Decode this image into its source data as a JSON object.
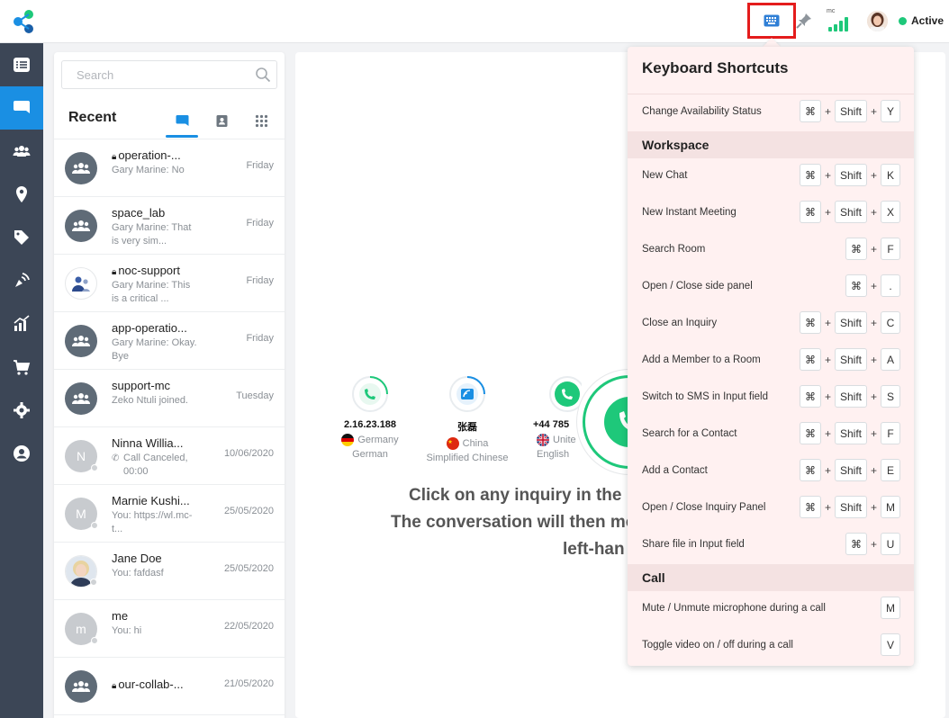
{
  "topbar": {
    "signal_label": "mc",
    "status_label": "Active",
    "status_color": "#1ec87a"
  },
  "nav": {
    "items": [
      "dashboard-icon",
      "chat-icon",
      "contacts-icon",
      "location-icon",
      "tag-icon",
      "broadcast-icon",
      "analytics-icon",
      "cart-icon",
      "settings-icon",
      "profile-icon"
    ],
    "active_index": 1,
    "accent": "#1a8fe3"
  },
  "recent": {
    "search_placeholder": "Search",
    "title": "Recent",
    "rows": [
      {
        "name": "operation-...",
        "locked": true,
        "preview": "Gary Marine: No",
        "date": "Friday",
        "avatar": "group"
      },
      {
        "name": "space_lab",
        "locked": false,
        "preview": "Gary Marine: That is very sim...",
        "date": "Friday",
        "avatar": "group"
      },
      {
        "name": "noc-support",
        "locked": true,
        "preview": "Gary Marine: This is a critical ...",
        "date": "Friday",
        "avatar": "people"
      },
      {
        "name": "app-operatio...",
        "locked": false,
        "preview": "Gary Marine: Okay. Bye",
        "date": "Friday",
        "avatar": "group"
      },
      {
        "name": "support-mc",
        "locked": false,
        "preview": "Zeko Ntuli joined.",
        "date": "Tuesday",
        "avatar": "group"
      },
      {
        "name": "Ninna Willia...",
        "locked": false,
        "preview": "Call Canceled, 00:00",
        "date": "10/06/2020",
        "avatar": "N"
      },
      {
        "name": "Marnie Kushi...",
        "locked": false,
        "preview": "You: https://wl.mc-t...",
        "date": "25/05/2020",
        "avatar": "M"
      },
      {
        "name": "Jane Doe",
        "locked": false,
        "preview": "You: fafdasf",
        "date": "25/05/2020",
        "avatar": "photo"
      },
      {
        "name": "me",
        "locked": false,
        "preview": "You: hi",
        "date": "22/05/2020",
        "avatar": "m"
      },
      {
        "name": "our-collab-...",
        "locked": true,
        "preview": "",
        "date": "21/05/2020",
        "avatar": "group"
      }
    ]
  },
  "main": {
    "numbers": [
      {
        "number": "2.16.23.188",
        "country": "Germany",
        "language": "German",
        "icon": "phone-icon"
      },
      {
        "number": "张磊",
        "country": "China",
        "language": "Simplified Chinese",
        "icon": "wifi-call-icon"
      },
      {
        "number": "+44 785",
        "country": "Unite",
        "language": "English",
        "icon": "phone-icon"
      }
    ],
    "hint_lines": [
      "Click on any inquiry in the in",
      "The conversation will then mo",
      "left-han"
    ]
  },
  "shortcuts": {
    "title": "Keyboard Shortcuts",
    "top": [
      {
        "label": "Change Availability Status",
        "keys": [
          "⌘",
          "Shift",
          "Y"
        ]
      }
    ],
    "sections": [
      {
        "title": "Workspace",
        "items": [
          {
            "label": "New Chat",
            "keys": [
              "⌘",
              "Shift",
              "K"
            ]
          },
          {
            "label": "New Instant Meeting",
            "keys": [
              "⌘",
              "Shift",
              "X"
            ]
          },
          {
            "label": "Search Room",
            "keys": [
              "⌘",
              "F"
            ]
          },
          {
            "label": "Open / Close side panel",
            "keys": [
              "⌘",
              "."
            ]
          },
          {
            "label": "Close an Inquiry",
            "keys": [
              "⌘",
              "Shift",
              "C"
            ]
          },
          {
            "label": "Add a Member to a Room",
            "keys": [
              "⌘",
              "Shift",
              "A"
            ]
          },
          {
            "label": "Switch to SMS in Input field",
            "keys": [
              "⌘",
              "Shift",
              "S"
            ]
          },
          {
            "label": "Search for a Contact",
            "keys": [
              "⌘",
              "Shift",
              "F"
            ]
          },
          {
            "label": "Add a Contact",
            "keys": [
              "⌘",
              "Shift",
              "E"
            ]
          },
          {
            "label": "Open / Close Inquiry Panel",
            "keys": [
              "⌘",
              "Shift",
              "M"
            ]
          },
          {
            "label": "Share file in Input field",
            "keys": [
              "⌘",
              "U"
            ]
          }
        ]
      },
      {
        "title": "Call",
        "items": [
          {
            "label": "Mute / Unmute microphone during a call",
            "keys": [
              "M"
            ]
          },
          {
            "label": "Toggle video on / off during a call",
            "keys": [
              "V"
            ]
          }
        ]
      }
    ]
  }
}
